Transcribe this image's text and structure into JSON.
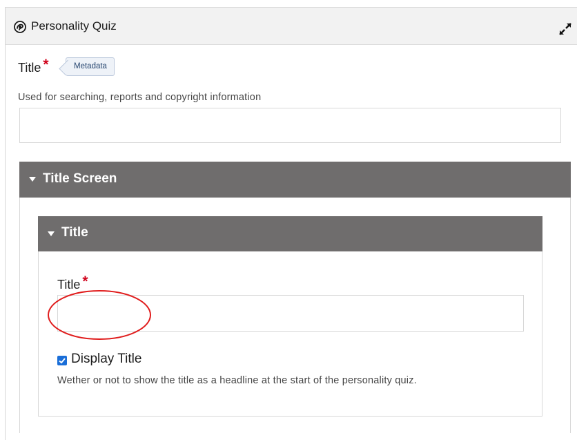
{
  "header": {
    "title": "Personality Quiz",
    "app_icon": "personality-quiz-icon",
    "expand_icon": "expand-icon"
  },
  "title_field": {
    "label": "Title",
    "required_marker": "*",
    "tag": "Metadata",
    "description": "Used for searching, reports and copyright information",
    "value": ""
  },
  "title_screen_group": {
    "label": "Title Screen",
    "inner_group": {
      "label": "Title",
      "field": {
        "label": "Title",
        "required_marker": "*",
        "value": ""
      },
      "display_title": {
        "label": "Display Title",
        "checked": true,
        "description": "Wether or not to show the title as a headline at the start of the personality quiz."
      }
    }
  },
  "colors": {
    "group_header": "#6f6d6d",
    "required": "#d0021b",
    "checkbox": "#1a6ed8",
    "annotation": "#e01c1c",
    "metadata_tag_bg": "#eef2f8"
  }
}
